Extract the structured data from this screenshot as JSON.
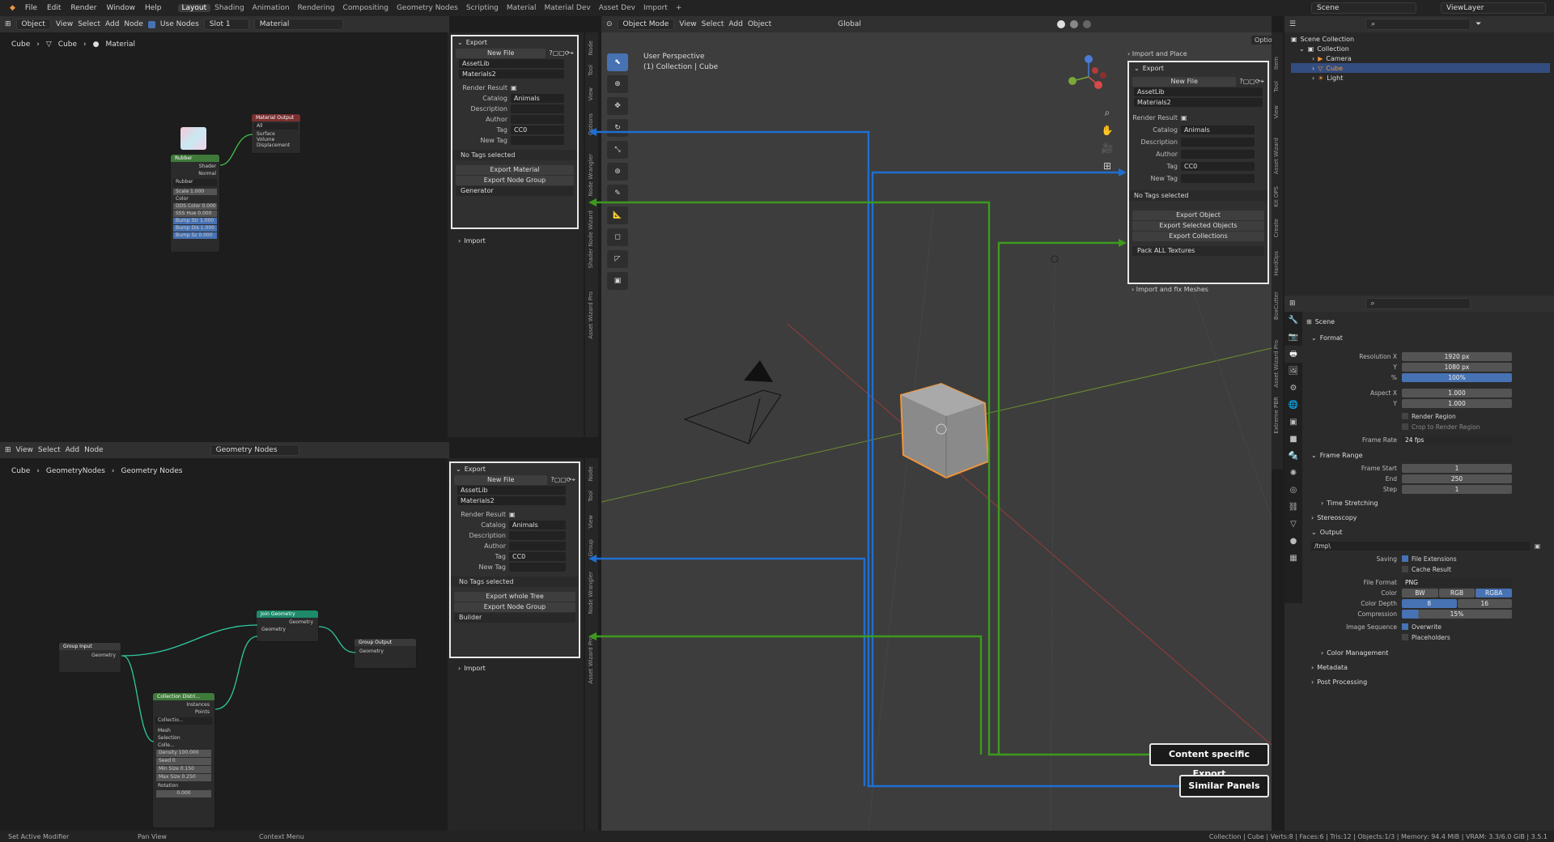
{
  "menubar": {
    "items": [
      "File",
      "Edit",
      "Render",
      "Window",
      "Help"
    ],
    "workspaces": [
      "Layout",
      "Shading",
      "Animation",
      "Rendering",
      "Compositing",
      "Geometry Nodes",
      "Scripting",
      "Material",
      "Material Dev",
      "Asset Dev",
      "Import"
    ],
    "active_workspace": "Layout",
    "scene": "Scene",
    "view_layer": "ViewLayer"
  },
  "shader_editor": {
    "header": {
      "mode": "Object",
      "menus": [
        "View",
        "Select",
        "Add",
        "Node"
      ],
      "use_nodes": "Use Nodes",
      "slot": "Slot 1",
      "material": "Material"
    },
    "breadcrumb": [
      "Cube",
      "Cube",
      "Material"
    ],
    "nodes": {
      "rubber": "Rubber",
      "output": "Material Output",
      "output_target": "All",
      "outputs": [
        "Surface",
        "Volume",
        "Displacement"
      ],
      "rubber_out": [
        "Shader",
        "Normal"
      ],
      "inner": "Rubber",
      "params": [
        "Scale 1.000",
        "Color",
        "DDS Color 0.000",
        "SSS Hue 0.000",
        "Bump Str 1.000",
        "Bump Dis 1.000",
        "Bump Sz 0.000"
      ]
    }
  },
  "panel_material": {
    "export": "Export",
    "new_file": "New File",
    "library": "AssetLib",
    "catalog_file": "Materials2",
    "render_result": "Render Result",
    "catalog_label": "Catalog",
    "catalog_value": "Animals",
    "description": "Description",
    "author": "Author",
    "tag": "Tag",
    "tag_value": "CC0",
    "new_tag": "New Tag",
    "no_tags": "No Tags selected",
    "btn1": "Export Material",
    "btn2": "Export Node Group",
    "type": "Generator",
    "import": "Import"
  },
  "panel_geo": {
    "export": "Export",
    "new_file": "New File",
    "library": "AssetLib",
    "catalog_file": "Materials2",
    "render_result": "Render Result",
    "catalog_label": "Catalog",
    "catalog_value": "Animals",
    "description": "Description",
    "author": "Author",
    "tag": "Tag",
    "tag_value": "CC0",
    "new_tag": "New Tag",
    "no_tags": "No Tags selected",
    "btn1": "Export whole Tree",
    "btn2": "Export Node Group",
    "type": "Builder",
    "import": "Import"
  },
  "panel_view": {
    "import_place": "Import and Place",
    "export": "Export",
    "new_file": "New File",
    "library": "AssetLib",
    "catalog_file": "Materials2",
    "render_result": "Render Result",
    "catalog_label": "Catalog",
    "catalog_value": "Animals",
    "description": "Description",
    "author": "Author",
    "tag": "Tag",
    "tag_value": "CC0",
    "new_tag": "New Tag",
    "no_tags": "No Tags selected",
    "btn1": "Export Object",
    "btn2": "Export Selected Objects",
    "btn3": "Export Collections",
    "pack": "Pack ALL Textures",
    "import_fix": "Import and fix Meshes"
  },
  "side_tabs_material": [
    "Node",
    "Tool",
    "View",
    "Options",
    "Node Wrangler",
    "Shader Node Wizard",
    "Asset Wizard Pro"
  ],
  "side_tabs_geo": [
    "Node",
    "Tool",
    "View",
    "Group",
    "Node Wrangler",
    "Asset Wizard Pro"
  ],
  "side_tabs_view": [
    "Item",
    "Tool",
    "View",
    "Asset Wizard",
    "Kit OPS",
    "Create",
    "HardOps",
    "BoxCutter",
    "Asset Wizard Pro",
    "Extreme PBR"
  ],
  "geo_editor": {
    "header": {
      "menus": [
        "View",
        "Select",
        "Add",
        "Node"
      ],
      "tree": "Geometry Nodes"
    },
    "breadcrumb": [
      "Cube",
      "GeometryNodes",
      "Geometry Nodes"
    ],
    "nodes": {
      "group_input": "Group Input",
      "geometry": "Geometry",
      "join": "Join Geometry",
      "group_output": "Group Output",
      "collection": "Collection Distri...",
      "instances": "Instances",
      "points": "Points",
      "collection_inner": "Collectio...",
      "mesh": "Mesh",
      "selection": "Selection",
      "coll": "Colle...",
      "density": "Density 100.000",
      "seed": "Seed 0",
      "min_size": "Min Size 0.150",
      "max_size": "Max Size 0.250",
      "rotation": "Rotation",
      "rot_val": "0.000"
    }
  },
  "viewport": {
    "header": {
      "mode": "Object Mode",
      "menus": [
        "View",
        "Select",
        "Add",
        "Object"
      ],
      "orientation": "Global",
      "options": "Options"
    },
    "perspective": "User Perspective",
    "collection": "(1) Collection | Cube"
  },
  "outliner": {
    "title": "Scene Collection",
    "items": [
      "Collection",
      "Camera",
      "Cube",
      "Light"
    ]
  },
  "properties": {
    "scene": "Scene",
    "format": "Format",
    "res_x_label": "Resolution X",
    "res_x": "1920 px",
    "res_y_label": "Y",
    "res_y": "1080 px",
    "pct_label": "%",
    "pct": "100%",
    "aspect_x_label": "Aspect X",
    "aspect_x": "1.000",
    "aspect_y_label": "Y",
    "aspect_y": "1.000",
    "render_region": "Render Region",
    "crop": "Crop to Render Region",
    "frame_rate_label": "Frame Rate",
    "frame_rate": "24 fps",
    "frame_range": "Frame Range",
    "start_label": "Frame Start",
    "start": "1",
    "end_label": "End",
    "end": "250",
    "step_label": "Step",
    "step": "1",
    "time_stretching": "Time Stretching",
    "stereoscopy": "Stereoscopy",
    "output": "Output",
    "path": "/tmp\\",
    "saving": "Saving",
    "file_ext": "File Extensions",
    "cache": "Cache Result",
    "file_format_label": "File Format",
    "file_format": "PNG",
    "color_label": "Color",
    "bw": "BW",
    "rgb": "RGB",
    "rgba": "RGBA",
    "depth_label": "Color Depth",
    "depth_8": "8",
    "depth_16": "16",
    "compression_label": "Compression",
    "compression": "15%",
    "seq_label": "Image Sequence",
    "overwrite": "Overwrite",
    "placeholders": "Placeholders",
    "color_mgmt": "Color Management",
    "metadata": "Metadata",
    "post": "Post Processing"
  },
  "callouts": {
    "content": "Content specific Export",
    "similar": "Similar Panels"
  },
  "statusbar": {
    "left": [
      "Set Active Modifier",
      "Pan View",
      "Context Menu"
    ],
    "right": "Collection | Cube | Verts:8 | Faces:6 | Tris:12 | Objects:1/3 | Memory: 94.4 MiB | VRAM: 3.3/6.0 GiB | 3.5.1"
  },
  "colors": {
    "blue": "#1f6fd1",
    "green": "#3d9a1e",
    "orange": "#f0953a"
  }
}
